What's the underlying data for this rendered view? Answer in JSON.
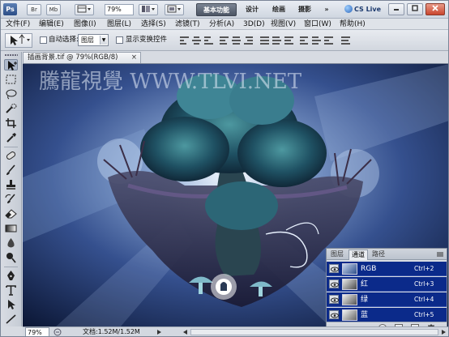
{
  "titlebar": {
    "logo": "Ps",
    "buttons": [
      "Br",
      "Mb"
    ],
    "zoom": "79%",
    "workspaces": [
      "基本功能",
      "设计",
      "绘画",
      "摄影"
    ],
    "overflow": "»",
    "cs_live": "CS Live"
  },
  "menu": [
    "文件(F)",
    "编辑(E)",
    "图像(I)",
    "图层(L)",
    "选择(S)",
    "滤镜(T)",
    "分析(A)",
    "3D(D)",
    "视图(V)",
    "窗口(W)",
    "帮助(H)"
  ],
  "options": {
    "auto_select_label": "自动选择:",
    "auto_select_value": "图层",
    "show_transform_label": "显示变换控件"
  },
  "document": {
    "tab_title": "插画背景.tif @ 79%(RGB/8)",
    "watermark": "騰龍視覺 WWW.TLVI.NET"
  },
  "status": {
    "zoom": "79%",
    "doc_info": "文档:1.52M/1.52M"
  },
  "channels": {
    "tabs": [
      "图层",
      "通道",
      "路径"
    ],
    "active_tab": "通道",
    "rows": [
      {
        "name": "RGB",
        "shortcut": "Ctrl+2"
      },
      {
        "name": "红",
        "shortcut": "Ctrl+3"
      },
      {
        "name": "绿",
        "shortcut": "Ctrl+4"
      },
      {
        "name": "蓝",
        "shortcut": "Ctrl+5"
      }
    ]
  },
  "colors": {
    "selection": "#0b2a8a",
    "canvas_dark": "#0a1d3d",
    "foliage": "#2f7a8a"
  }
}
